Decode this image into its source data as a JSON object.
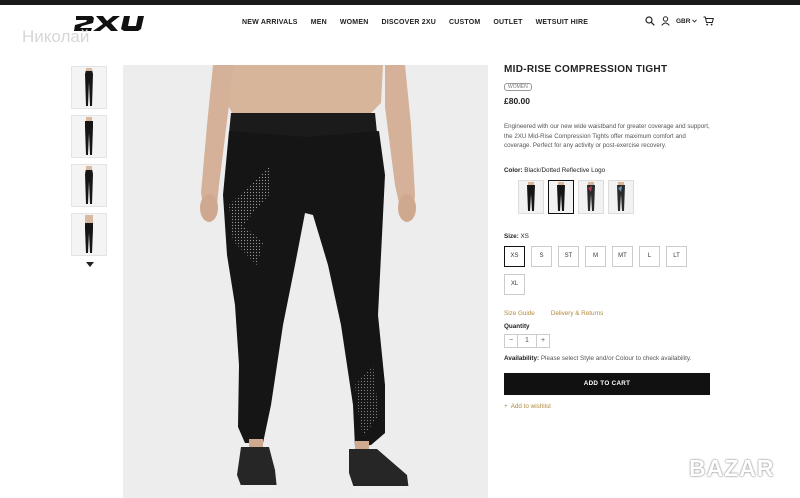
{
  "watermark_top": "Николай",
  "watermark_bottom": "BAZAR",
  "header": {
    "nav": [
      "NEW ARRIVALS",
      "MEN",
      "WOMEN",
      "DISCOVER 2XU",
      "CUSTOM",
      "OUTLET",
      "WETSUIT HIRE"
    ],
    "region": "GBR"
  },
  "product": {
    "title": "MID-RISE COMPRESSION TIGHT",
    "badge": "WOMEN",
    "price": "£80.00",
    "description": "Engineered with our new wide waistband for greater coverage and support, the 2XU Mid-Rise Compression Tights offer maximum comfort and coverage. Perfect for any activity or post-exercise recovery.",
    "color_label": "Color:",
    "color_value": "Black/Dotted Reflective Logo",
    "size_label": "Size:",
    "size_value": "XS",
    "sizes": [
      "XS",
      "S",
      "ST",
      "M",
      "MT",
      "L",
      "LT",
      "XL"
    ],
    "size_guide": "Size Guide",
    "delivery": "Delivery & Returns",
    "quantity_label": "Quantity",
    "quantity": "1",
    "availability_label": "Availability:",
    "availability_text": "Please select Style and/or Colour to check availability.",
    "add_to_cart": "ADD TO CART",
    "wishlist": "Add to wishlist"
  },
  "colors": {
    "accent": "#b08a3c",
    "cart_bg": "#111111",
    "topbar": "#1a1a1a"
  }
}
